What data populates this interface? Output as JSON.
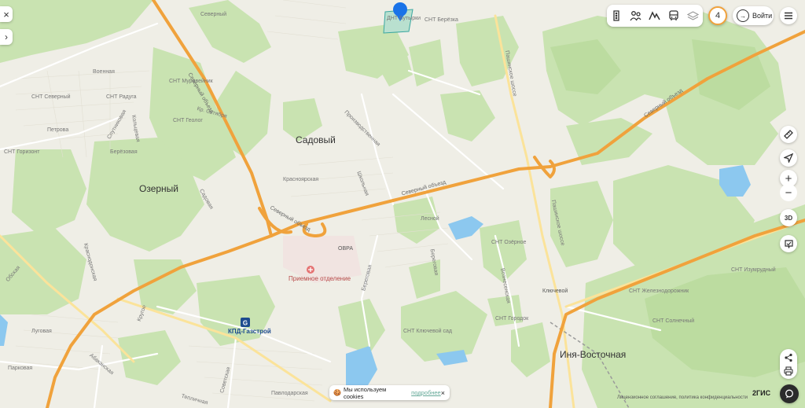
{
  "map": {
    "places": {
      "sadovy": "Садовый",
      "ozerny": "Озерный",
      "inya_vostochnaya": "Иня-Восточная",
      "klyuchevoy": "Ключевой",
      "ovra": "ОВРА"
    },
    "roads": {
      "severny_obezd_1": "Северный объезд",
      "severny_obezd_2": "Северный объезд",
      "severny_obezd_3": "Северный объезд",
      "severny_obezd_4": "Северный объезд",
      "proizvodstvennaya": "Производственная",
      "krasnoyarskaya": "Красноярская",
      "shkolnaya": "Школьная",
      "beregovaya": "Береговая",
      "lesnoy": "Лесной",
      "krugoe": "Кругое",
      "bereg": "Береговая",
      "pashino": "Пашинское шоссе",
      "pashino_2": "Пашинское шоссе",
      "kr_oktyabrya": "Кр. Октября",
      "kolcevaya": "Кольцевая",
      "sputnik": "Спутниковая",
      "voennaya": "Военная",
      "berezovaya": "Берёзовая",
      "petrov": "Петрова",
      "krasnodonskaya": "Краснодонская",
      "obskaya": "Обская",
      "abakanskaya": "Абаканская",
      "teplichnaya": "Тепличная",
      "sovetskaya": "Советская",
      "lugovaya": "Луговая",
      "parkovaya": "Парковая",
      "severny_small": "Северный",
      "sadovaya": "Садовая",
      "voznesenskaya": "Вознесенская",
      "pavlodarskaya": "Павлодарская"
    },
    "areas": {
      "snt_berezka": "СНТ Берёзка",
      "snt_gorizont": "СНТ Горизонт",
      "snt_ozerny": "СНТ Озёрное",
      "snt_muravey": "СНТ Муравейник",
      "snt_gorodok": "СНТ Городок",
      "snt_kluch": "СНТ Ключевой сад",
      "snt_butirki": "ДНТ Бутырки",
      "snt_gerold": "СНТ Геолог",
      "snt_zheleznodor": "СНТ Железнодорожник",
      "snt_solnechny": "СНТ Солнечный",
      "snt_raduga": "СНТ Радуга",
      "snt_severny": "СНТ Северный",
      "snt_izumrudny": "СНТ Изумрудный"
    },
    "pois": {
      "priemnoe": "Приемное отделение",
      "kpd": "КПД-Газстрой"
    },
    "colors": {
      "background": "#efeee6",
      "forest": "#c9e3b1",
      "forest_dark": "#bcdca0",
      "highway": "#f0a23c",
      "water": "#8cc8ef",
      "railway": "#9a9a9a",
      "marker": "#1a73e8"
    }
  },
  "controls": {
    "close": "×",
    "expand": "›",
    "top_icons": [
      "traffic-light-icon",
      "friends-icon",
      "mountain-icon",
      "bus-icon",
      "layers-icon"
    ],
    "notification_count": "4",
    "login": "Войти",
    "menu_icon": "menu-icon",
    "ruler_icon": "ruler-icon",
    "locate_icon": "locate-icon",
    "zoom_in": "+",
    "zoom_out": "−",
    "mode_3d": "3D",
    "pin_icon": "pin-icon",
    "share_icon": "share-icon",
    "print_icon": "print-icon",
    "chat_icon": "chat-icon"
  },
  "cookie_banner": {
    "emoji": "🍪",
    "text": "Мы используем cookies",
    "link": "подробнее",
    "close": "×"
  },
  "footer": {
    "legal": "Лицензионное соглашение, политика конфиденциальности",
    "brand": "2ГИС"
  }
}
